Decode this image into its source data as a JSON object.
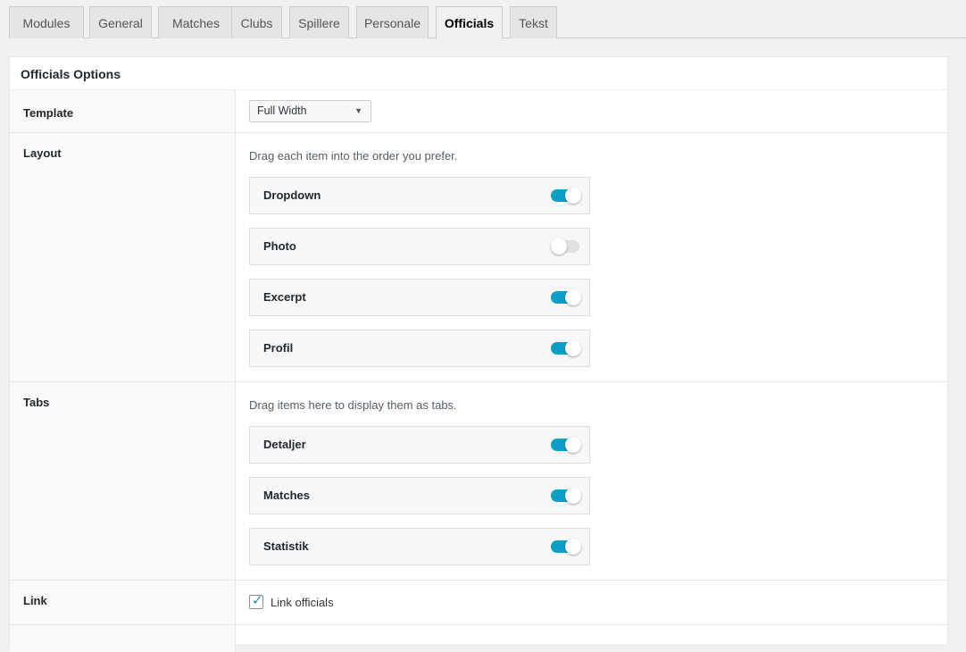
{
  "tabs": [
    {
      "label": "Modules",
      "active": false
    },
    {
      "label": "General",
      "active": false
    },
    {
      "label": "Matches",
      "active": false
    },
    {
      "label": "Clubs",
      "active": false
    },
    {
      "label": "Spillere",
      "active": false
    },
    {
      "label": "Personale",
      "active": false
    },
    {
      "label": "Officials",
      "active": true
    },
    {
      "label": "Tekst",
      "active": false
    }
  ],
  "panel": {
    "title": "Officials Options",
    "template": {
      "label": "Template",
      "selected": "Full Width"
    },
    "layout": {
      "label": "Layout",
      "description": "Drag each item into the order you prefer.",
      "items": [
        {
          "label": "Dropdown",
          "enabled": true
        },
        {
          "label": "Photo",
          "enabled": false
        },
        {
          "label": "Excerpt",
          "enabled": true
        },
        {
          "label": "Profil",
          "enabled": true
        }
      ]
    },
    "tabs": {
      "label": "Tabs",
      "description": "Drag items here to display them as tabs.",
      "items": [
        {
          "label": "Detaljer",
          "enabled": true
        },
        {
          "label": "Matches",
          "enabled": true
        },
        {
          "label": "Statistik",
          "enabled": true
        }
      ]
    },
    "link": {
      "label": "Link",
      "checkbox_label": "Link officials",
      "checked": true
    }
  },
  "colors": {
    "accent": "#0b9fc5",
    "checkbox": "#1e8cbe"
  },
  "icons": {
    "select_arrow": "caret-down-icon",
    "checkbox": "checkmark-icon"
  }
}
